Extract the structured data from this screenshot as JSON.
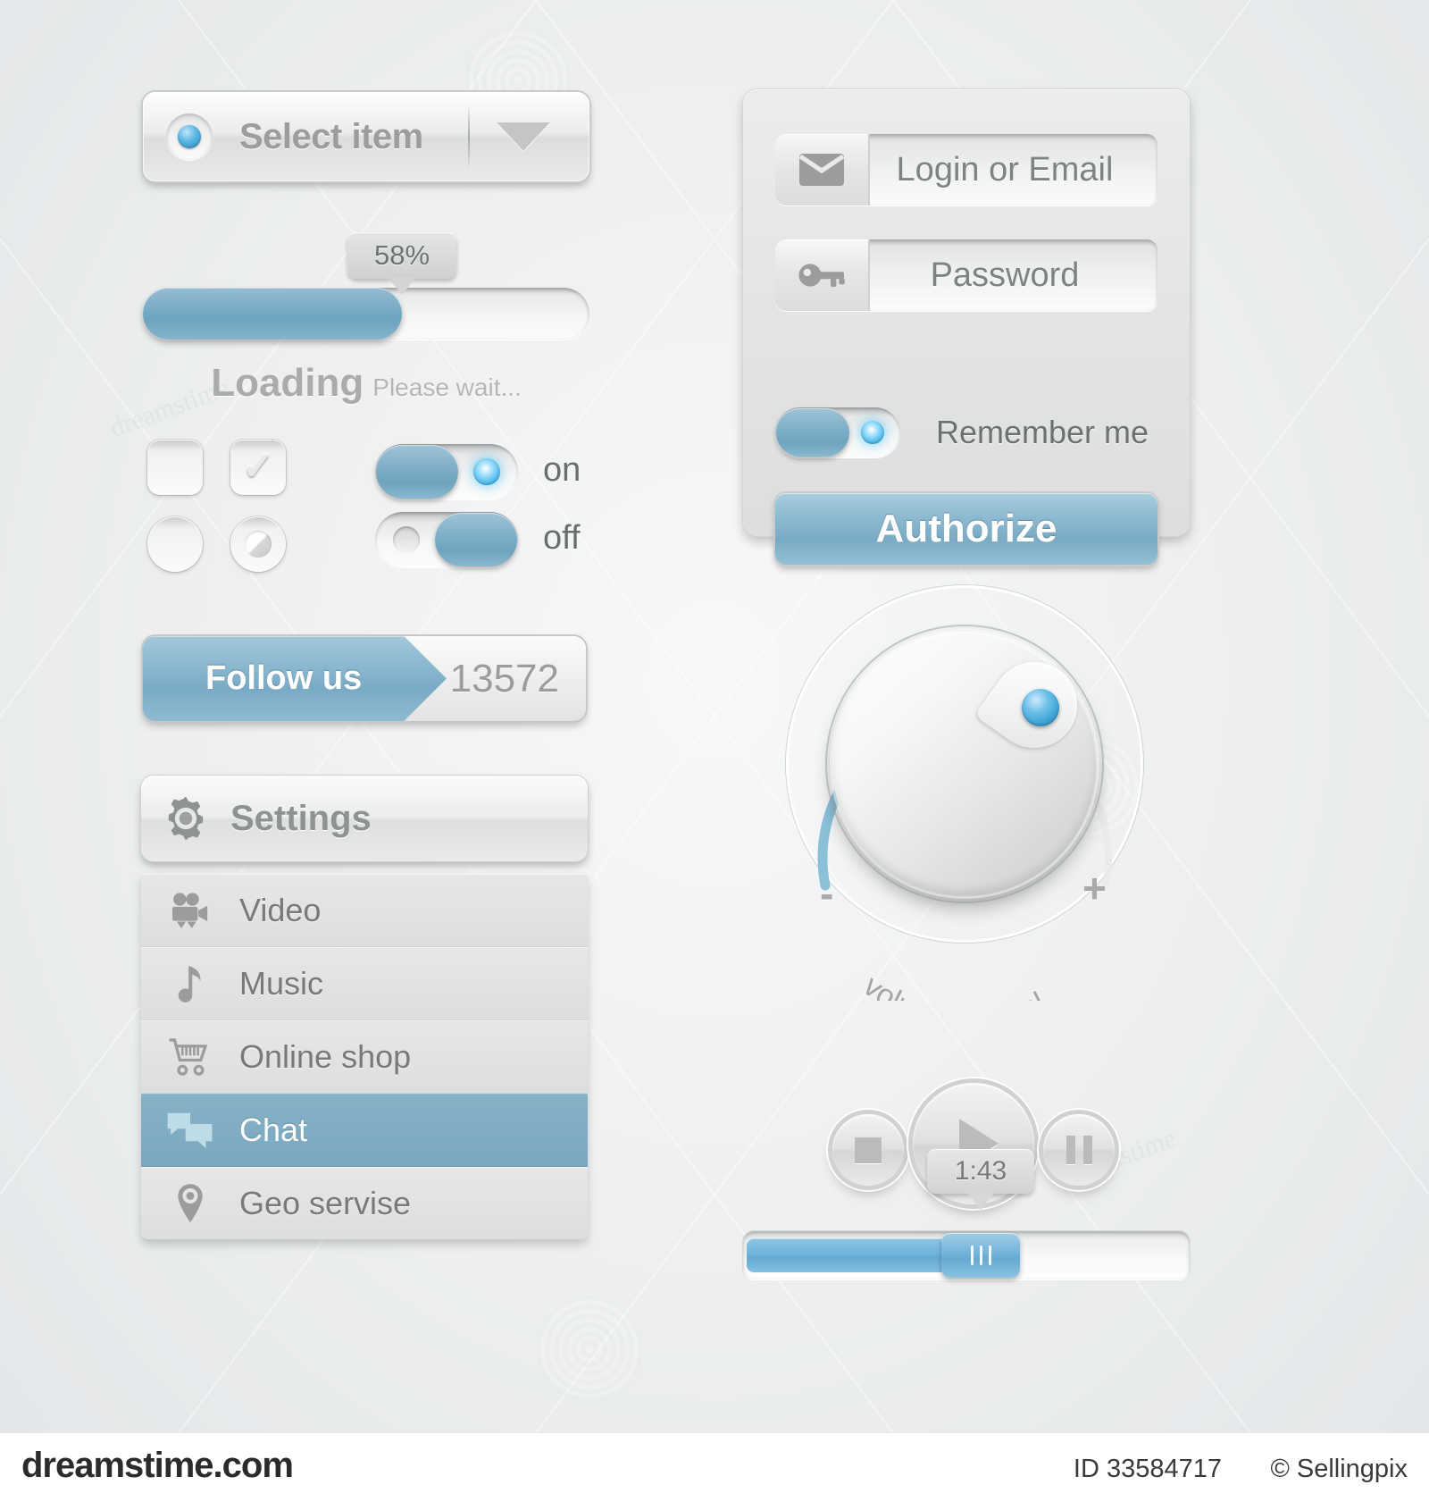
{
  "select": {
    "label": "Select item",
    "bullet_icon": "blue-dot-icon",
    "caret_icon": "chevron-down-icon"
  },
  "progress": {
    "percent_label": "58%",
    "percent_value": 58,
    "loading_title": "Loading",
    "loading_hint": "Please wait..."
  },
  "controls": {
    "checkbox_unchecked_name": "checkbox-unchecked",
    "checkbox_checked_name": "checkbox-checked",
    "checkbox_tick": "✓",
    "radio_unchecked_name": "radio-unchecked",
    "radio_checked_name": "radio-checked",
    "toggle_on_label": "on",
    "toggle_off_label": "off"
  },
  "follow": {
    "label": "Follow us",
    "count": "13572"
  },
  "settings": {
    "header": "Settings",
    "header_icon": "gear-icon",
    "items": [
      {
        "label": "Video",
        "icon": "video-camera-icon",
        "active": false
      },
      {
        "label": "Music",
        "icon": "music-note-icon",
        "active": false
      },
      {
        "label": "Online shop",
        "icon": "shopping-cart-icon",
        "active": false
      },
      {
        "label": "Chat",
        "icon": "chat-bubbles-icon",
        "active": true
      },
      {
        "label": "Geo servise",
        "icon": "map-pin-icon",
        "active": false
      }
    ]
  },
  "login": {
    "email_value": "Login or Email",
    "email_icon": "envelope-icon",
    "password_value": "Password",
    "password_icon": "key-icon",
    "remember_label": "Remember me",
    "remember_on": true,
    "authorize_label": "Authorize"
  },
  "volume": {
    "caption": "volume control",
    "minus_label": "-",
    "plus_label": "+",
    "arc_value": 72
  },
  "player": {
    "stop_icon": "stop-icon",
    "play_icon": "play-icon",
    "pause_icon": "pause-icon",
    "time_label": "1:43",
    "position_percent": 50
  },
  "footer": {
    "brand": "dreamstime.com",
    "image_id": "ID 33584717",
    "author": "© Sellingpix"
  },
  "colors": {
    "accent_blue": "#7aabc4",
    "accent_blue_dark": "#6e9fba",
    "led_blue": "#3aaee2",
    "panel_grey": "#e3e4e4",
    "text_grey": "#7f8283"
  },
  "watermark": {
    "text": "dreamstime"
  }
}
